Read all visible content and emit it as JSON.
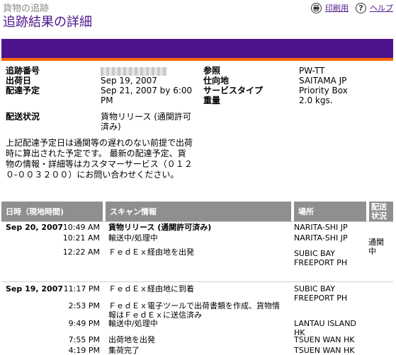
{
  "header": {
    "breadcrumb": "貨物の追跡",
    "title": "追跡結果の詳細",
    "print_label": "印刷用",
    "help_label": "ヘルプ"
  },
  "icons": {
    "print": "printer-icon",
    "help": "question-icon"
  },
  "colors": {
    "brand_purple": "#4d148c",
    "brand_orange": "#ff6600",
    "header_gray": "#8f8f8f"
  },
  "summary": {
    "tracking_label": "追跡番号",
    "ship_date_label": "出荷日",
    "ship_date": "Sep 19, 2007",
    "delivery_label": "配達予定",
    "delivery_line1": "Sep 21, 2007 by 6:00",
    "delivery_line2": "PM",
    "status_label": "配送状況",
    "status_line1": "貨物リリース (通関許可",
    "status_line2": "済み)",
    "ref_label": "参照",
    "ref_value": "PW-TT",
    "dest_label": "仕向地",
    "dest_value": "SAITAMA JP",
    "service_label": "サービスタイプ",
    "service_value": "Priority Box",
    "weight_label": "重量",
    "weight_value": "2.0 kgs."
  },
  "note": {
    "line1": "上記配達予定日は通関等の遅れのない前提で出荷",
    "line2": "時に算出された予定です。 最新の配達予定、貨",
    "line3": "物の情報・詳細等はカスタマーサービス（０１２",
    "line4": "０-００３２００）にお問い合わせください。"
  },
  "table": {
    "col_datetime": "日時（現地時間)",
    "col_scan": "スキャン情報",
    "col_location": "場所",
    "col_status_1": "配送",
    "col_status_2": "状況"
  },
  "events": [
    {
      "date": "Sep 20, 2007",
      "time": "10:49 AM",
      "scan": "貨物リリース (通関許可済み)",
      "location": "NARITA-SHI JP"
    },
    {
      "time": "10:21 AM",
      "scan": "輸送中/処理中",
      "location": "NARITA-SHI JP",
      "status_1": "通関",
      "status_2": "中"
    },
    {
      "time": "12:22 AM",
      "scan": "ＦｅｄＥｘ経由地を出発",
      "location_1": "SUBIC BAY",
      "location_2": "FREEPORT PH"
    },
    {
      "date": "Sep 19, 2007",
      "time": "11:17 PM",
      "scan": "ＦｅｄＥｘ経由地に到着",
      "location_1": "SUBIC BAY",
      "location_2": "FREEPORT PH"
    },
    {
      "time": "2:53 PM",
      "scan_1": "ＦｅｄＥｘ電子ツールで出荷書類を作成、貨物情",
      "scan_2": "報はＦｅｄＥｘに送信済み"
    },
    {
      "time": "9:49 PM",
      "scan": "輸送中/処理中",
      "location_1": "LANTAU ISLAND",
      "location_2": "HK"
    },
    {
      "time": "7:55 PM",
      "scan": "出荷地を出発",
      "location": "TSUEN WAN HK"
    },
    {
      "time": "4:19 PM",
      "scan": "集荷完了",
      "location": "TSUEN WAN HK"
    }
  ]
}
